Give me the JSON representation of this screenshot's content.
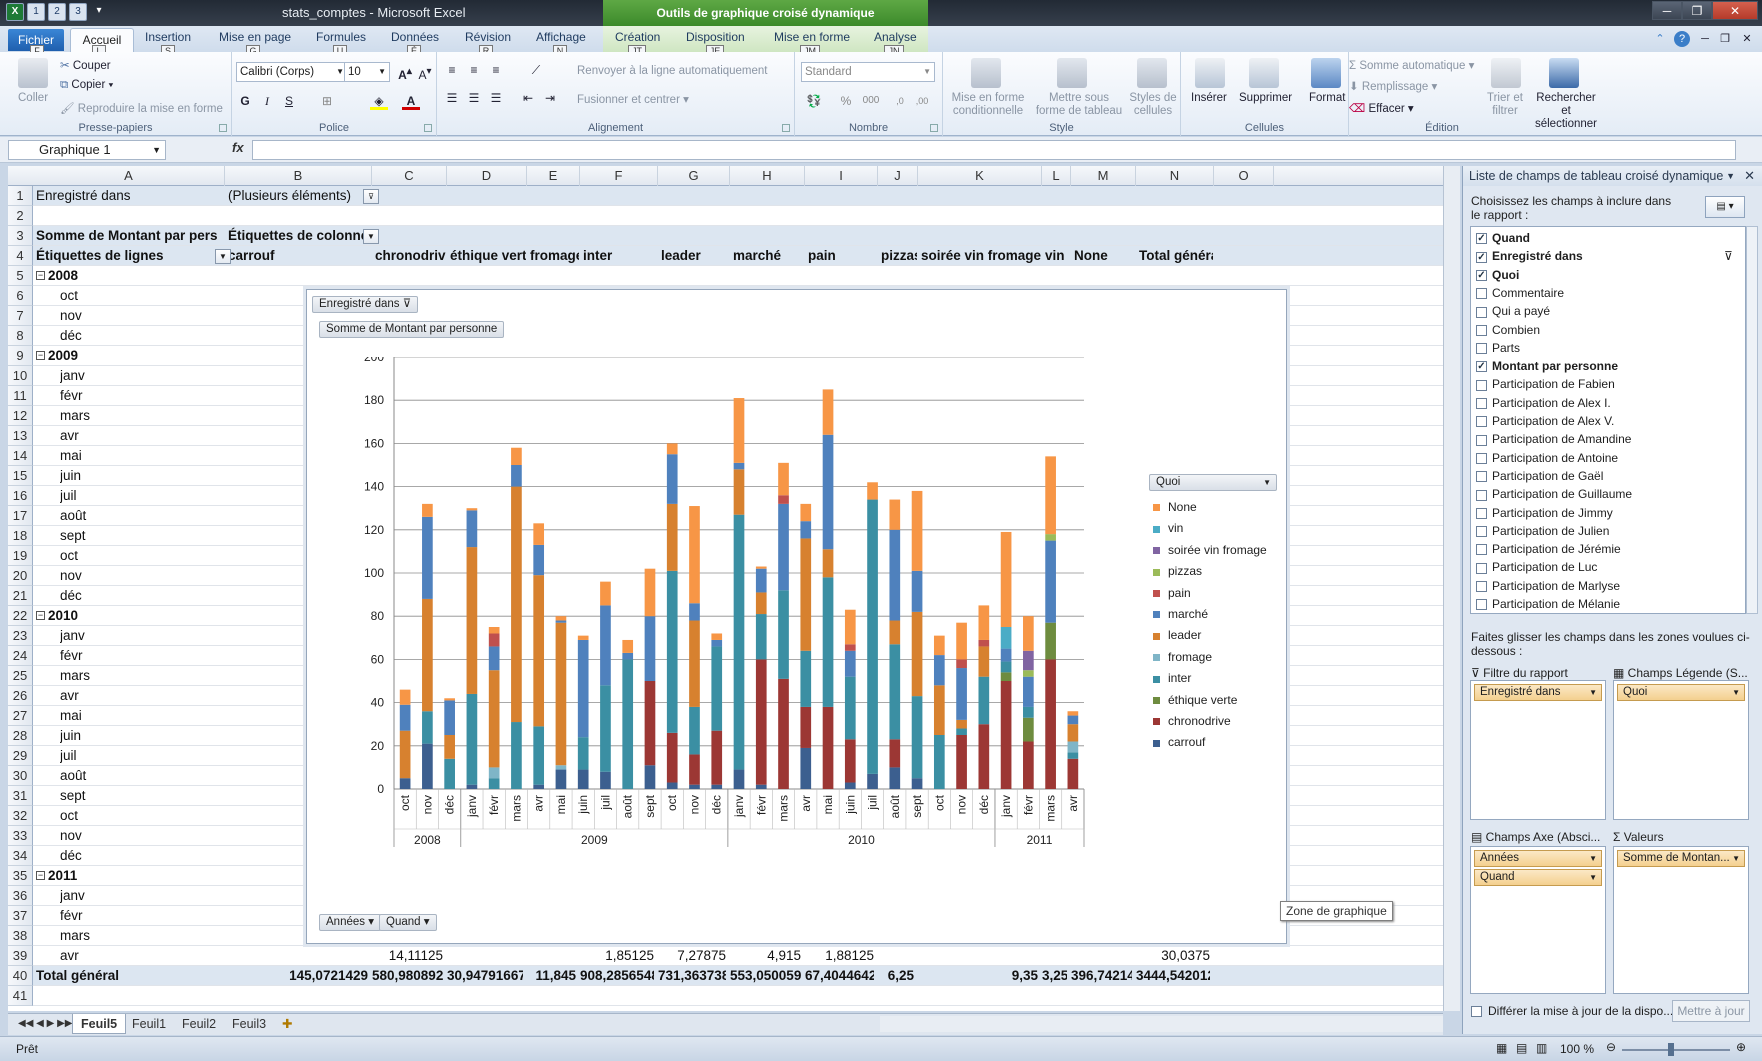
{
  "window": {
    "title": "stats_comptes  -  Microsoft Excel",
    "context_tab_title": "Outils de graphique croisé dynamique"
  },
  "qat_keytips": [
    "1",
    "2",
    "3"
  ],
  "tabs": [
    {
      "label": "Fichier",
      "key": "F"
    },
    {
      "label": "Accueil",
      "key": "L"
    },
    {
      "label": "Insertion",
      "key": "S"
    },
    {
      "label": "Mise en page",
      "key": "G"
    },
    {
      "label": "Formules",
      "key": "U"
    },
    {
      "label": "Données",
      "key": "É"
    },
    {
      "label": "Révision",
      "key": "R"
    },
    {
      "label": "Affichage",
      "key": "N"
    },
    {
      "label": "Création",
      "key": "JT"
    },
    {
      "label": "Disposition",
      "key": "JE"
    },
    {
      "label": "Mise en forme",
      "key": "JM"
    },
    {
      "label": "Analyse",
      "key": "JN"
    }
  ],
  "ribbon": {
    "clipboard": {
      "label": "Presse-papiers",
      "paste": "Coller",
      "cut": "Couper",
      "copy": "Copier",
      "format_painter": "Reproduire la mise en forme"
    },
    "font": {
      "label": "Police",
      "name": "Calibri (Corps)",
      "size": "10",
      "bold": "G",
      "italic": "I",
      "underline": "S"
    },
    "alignment": {
      "label": "Alignement",
      "wrap": "Renvoyer à la ligne automatiquement",
      "merge": "Fusionner et centrer"
    },
    "number": {
      "label": "Nombre",
      "format": "Standard",
      "percent": "%",
      "thousands": "000"
    },
    "style": {
      "label": "Style",
      "conditional": "Mise en forme conditionnelle",
      "as_table": "Mettre sous forme de tableau",
      "cell_styles": "Styles de cellules"
    },
    "cells": {
      "label": "Cellules",
      "insert": "Insérer",
      "delete": "Supprimer",
      "format": "Format"
    },
    "editing": {
      "label": "Édition",
      "autosum": "Somme automatique",
      "fill": "Remplissage",
      "clear": "Effacer",
      "sort": "Trier et filtrer",
      "find": "Rechercher et sélectionner"
    }
  },
  "formula_bar": {
    "name_box": "Graphique 1",
    "fx": "fx",
    "value": ""
  },
  "columns": [
    "A",
    "B",
    "C",
    "D",
    "E",
    "F",
    "G",
    "H",
    "I",
    "J",
    "K",
    "L",
    "M",
    "N",
    "O"
  ],
  "rows": [
    {
      "n": "1",
      "cells": {
        "A": "Enregistré dans",
        "B": "(Plusieurs éléments)"
      }
    },
    {
      "n": "2",
      "cells": {}
    },
    {
      "n": "3",
      "cells": {
        "A": "Somme de Montant par personne",
        "B": "Étiquettes de colonnes"
      }
    },
    {
      "n": "4",
      "cells": {
        "A": "Étiquettes de lignes",
        "B": "carrouf",
        "C": "chronodrive",
        "D": "éthique verte",
        "E": "fromage",
        "F": "inter",
        "G": "leader",
        "H": "marché",
        "I": "pain",
        "J": "pizzas",
        "K": "soirée vin fromage",
        "L": "vin",
        "M": "None",
        "N": "Total général"
      }
    },
    {
      "n": "5",
      "cells": {
        "A": "2008"
      },
      "group": true
    },
    {
      "n": "6",
      "cells": {
        "A": "oct",
        "N": "45,68"
      }
    },
    {
      "n": "7",
      "cells": {
        "A": "nov",
        "N": "132,0861905"
      }
    },
    {
      "n": "8",
      "cells": {
        "A": "déc",
        "N": "42,19833333"
      }
    },
    {
      "n": "9",
      "cells": {
        "A": "2009"
      },
      "group": true
    },
    {
      "n": "10",
      "cells": {
        "A": "janv",
        "N": "130,1457143"
      }
    },
    {
      "n": "11",
      "cells": {
        "A": "févr",
        "N": "69,30671429"
      }
    },
    {
      "n": "12",
      "cells": {
        "A": "mars",
        "N": "157,207619"
      }
    },
    {
      "n": "13",
      "cells": {
        "A": "avr",
        "N": "123,1095238"
      }
    },
    {
      "n": "14",
      "cells": {
        "A": "mai",
        "N": "80,89"
      }
    },
    {
      "n": "15",
      "cells": {
        "A": "juin",
        "N": "71,04142857"
      }
    },
    {
      "n": "16",
      "cells": {
        "A": "juil",
        "N": "104,9130952"
      }
    },
    {
      "n": "17",
      "cells": {
        "A": "août",
        "N": "69,32833333"
      }
    },
    {
      "n": "18",
      "cells": {
        "A": "sept",
        "N": "103,3485714"
      }
    },
    {
      "n": "19",
      "cells": {
        "A": "oct",
        "N": "159,3019048"
      }
    },
    {
      "n": "20",
      "cells": {
        "A": "nov",
        "N": "130,2464286"
      }
    },
    {
      "n": "21",
      "cells": {
        "A": "déc",
        "N": "72,54"
      }
    },
    {
      "n": "22",
      "cells": {
        "A": "2010"
      },
      "group": true
    },
    {
      "n": "23",
      "cells": {
        "A": "janv",
        "N": "180,5357143"
      }
    },
    {
      "n": "24",
      "cells": {
        "A": "févr",
        "N": "103,6347619"
      }
    },
    {
      "n": "25",
      "cells": {
        "A": "mars",
        "N": "150,9516667"
      }
    },
    {
      "n": "26",
      "cells": {
        "A": "avr",
        "N": "132,2630952"
      }
    },
    {
      "n": "27",
      "cells": {
        "A": "mai",
        "N": "185,0585714"
      }
    },
    {
      "n": "28",
      "cells": {
        "A": "juin",
        "N": "100,6852381"
      }
    },
    {
      "n": "29",
      "cells": {
        "A": "juil",
        "N": "141,5328095"
      }
    },
    {
      "n": "30",
      "cells": {
        "A": "août",
        "N": "132,5071429"
      }
    },
    {
      "n": "31",
      "cells": {
        "A": "sept",
        "N": "139,502857"
      }
    },
    {
      "n": "32",
      "cells": {
        "A": "oct",
        "N": "97,31285714"
      }
    },
    {
      "n": "33",
      "cells": {
        "A": "nov",
        "N": "75,77714286"
      }
    },
    {
      "n": "34",
      "cells": {
        "A": "déc",
        "N": "85,54880952"
      }
    },
    {
      "n": "35",
      "cells": {
        "A": "2011"
      },
      "group": true
    },
    {
      "n": "36",
      "cells": {
        "A": "janv",
        "N": "128,9645238"
      }
    },
    {
      "n": "37",
      "cells": {
        "A": "févr",
        "N": "113,6011905"
      }
    },
    {
      "n": "38",
      "cells": {
        "A": "mars",
        "N": "154,5212501"
      }
    },
    {
      "n": "39",
      "cells": {
        "A": "avr",
        "C": "14,11125",
        "F": "1,85125",
        "G": "7,27875",
        "H": "4,915",
        "I": "1,88125",
        "N": "30,0375"
      }
    },
    {
      "n": "40",
      "cells": {
        "A": "Total général",
        "B": "145,0721429",
        "C": "580,9808929",
        "D": "30,94791667",
        "E": "11,845",
        "F": "908,2856548",
        "G": "731,3637381",
        "H": "553,0500595",
        "I": "67,40446429",
        "J": "6,25",
        "K": "9,35",
        "L": "3,25",
        "M": "396,742143",
        "N": "3444,542012"
      },
      "total": true
    },
    {
      "n": "41",
      "cells": {}
    }
  ],
  "chart_buttons": {
    "report_filter": "Enregistré dans",
    "values": "Somme de Montant par personne",
    "legend_field": "Quoi",
    "axis_years": "Années",
    "axis_when": "Quand"
  },
  "chart_tooltip": "Zone de graphique",
  "chart_data": {
    "type": "bar",
    "stacked": true,
    "ylim": [
      0,
      200
    ],
    "yticks": [
      0,
      20,
      40,
      60,
      80,
      100,
      120,
      140,
      160,
      180,
      200
    ],
    "grid": true,
    "legend_placement": "right",
    "categories": [
      "oct",
      "nov",
      "déc",
      "janv",
      "févr",
      "mars",
      "avr",
      "mai",
      "juin",
      "juil",
      "août",
      "sept",
      "oct",
      "nov",
      "déc",
      "janv",
      "févr",
      "mars",
      "avr",
      "mai",
      "juin",
      "juil",
      "août",
      "sept",
      "oct",
      "nov",
      "déc",
      "janv",
      "févr",
      "mars",
      "avr"
    ],
    "year_groups": [
      {
        "label": "2008",
        "count": 3
      },
      {
        "label": "2009",
        "count": 12
      },
      {
        "label": "2010",
        "count": 12
      },
      {
        "label": "2011",
        "count": 4
      }
    ],
    "series": [
      {
        "name": "carrouf",
        "color": "#3c5f8f",
        "values": [
          5,
          21,
          0,
          2,
          0,
          0,
          2,
          9,
          9,
          8,
          0,
          11,
          3,
          2,
          2,
          9,
          2,
          0,
          19,
          0,
          3,
          7,
          10,
          5,
          0,
          0,
          0,
          0,
          0,
          0,
          0
        ]
      },
      {
        "name": "chronodrive",
        "color": "#9c3734",
        "values": [
          0,
          0,
          0,
          0,
          0,
          0,
          0,
          0,
          0,
          0,
          0,
          39,
          23,
          14,
          25,
          0,
          58,
          51,
          19,
          38,
          20,
          0,
          13,
          0,
          0,
          25,
          30,
          50,
          22,
          60,
          14
        ]
      },
      {
        "name": "éthique verte",
        "color": "#6e8c3f",
        "values": [
          0,
          0,
          0,
          0,
          0,
          0,
          0,
          0,
          0,
          0,
          0,
          0,
          0,
          0,
          0,
          0,
          0,
          0,
          0,
          0,
          0,
          0,
          0,
          0,
          0,
          0,
          0,
          4,
          11,
          17,
          0
        ]
      },
      {
        "name": "inter",
        "color": "#3b8fa3",
        "values": [
          0,
          15,
          14,
          42,
          5,
          31,
          27,
          0,
          15,
          40,
          60,
          0,
          75,
          22,
          39,
          118,
          21,
          41,
          26,
          60,
          29,
          127,
          44,
          38,
          25,
          3,
          22,
          5,
          5,
          0,
          3
        ]
      },
      {
        "name": "fromage",
        "color": "#7fb5c7",
        "values": [
          0,
          0,
          0,
          0,
          5,
          0,
          0,
          2,
          0,
          0,
          0,
          0,
          0,
          0,
          0,
          0,
          0,
          0,
          0,
          0,
          0,
          0,
          0,
          0,
          0,
          0,
          0,
          0,
          0,
          0,
          5
        ]
      },
      {
        "name": "leader",
        "color": "#d7812f",
        "values": [
          22,
          52,
          11,
          68,
          45,
          109,
          70,
          66,
          0,
          0,
          0,
          0,
          31,
          40,
          0,
          21,
          10,
          0,
          52,
          13,
          0,
          0,
          11,
          39,
          23,
          4,
          14,
          0,
          0,
          0,
          8
        ]
      },
      {
        "name": "marché",
        "color": "#4f81bd",
        "values": [
          12,
          38,
          16,
          17,
          11,
          10,
          14,
          1,
          45,
          37,
          3,
          30,
          23,
          8,
          3,
          3,
          11,
          40,
          8,
          53,
          12,
          0,
          42,
          19,
          14,
          24,
          0,
          6,
          14,
          38,
          4
        ]
      },
      {
        "name": "pain",
        "color": "#c0504d",
        "values": [
          0,
          0,
          0,
          0,
          6,
          0,
          0,
          0,
          0,
          0,
          0,
          0,
          0,
          0,
          0,
          0,
          0,
          4,
          0,
          0,
          3,
          0,
          0,
          0,
          0,
          4,
          3,
          0,
          0,
          0,
          0
        ]
      },
      {
        "name": "pizzas",
        "color": "#9bbb59",
        "values": [
          0,
          0,
          0,
          0,
          0,
          0,
          0,
          0,
          0,
          0,
          0,
          0,
          0,
          0,
          0,
          0,
          0,
          0,
          0,
          0,
          0,
          0,
          0,
          0,
          0,
          0,
          0,
          0,
          3,
          3,
          0
        ]
      },
      {
        "name": "soirée vin fromage",
        "color": "#8064a2",
        "values": [
          0,
          0,
          0,
          0,
          0,
          0,
          0,
          0,
          0,
          0,
          0,
          0,
          0,
          0,
          0,
          0,
          0,
          0,
          0,
          0,
          0,
          0,
          0,
          0,
          0,
          0,
          0,
          0,
          9,
          0,
          0
        ]
      },
      {
        "name": "vin",
        "color": "#4bacc6",
        "values": [
          0,
          0,
          0,
          0,
          0,
          0,
          0,
          0,
          0,
          0,
          0,
          0,
          0,
          0,
          0,
          0,
          0,
          0,
          0,
          0,
          0,
          0,
          0,
          0,
          0,
          0,
          0,
          10,
          0,
          0,
          0
        ]
      },
      {
        "name": "None",
        "color": "#f79646",
        "values": [
          7,
          6,
          1,
          1,
          3,
          8,
          10,
          2,
          2,
          11,
          6,
          22,
          5,
          45,
          3,
          30,
          1,
          15,
          8,
          21,
          16,
          8,
          14,
          37,
          9,
          17,
          16,
          44,
          16,
          36,
          2
        ]
      }
    ]
  },
  "sheets": [
    {
      "name": "Feuil5",
      "active": true
    },
    {
      "name": "Feuil1"
    },
    {
      "name": "Feuil2"
    },
    {
      "name": "Feuil3"
    }
  ],
  "status": {
    "ready": "Prêt",
    "zoom": "100 %"
  },
  "pane": {
    "title": "Liste de champs de tableau croisé dynamique",
    "desc": "Choisissez les champs à inclure dans le rapport :",
    "fields": [
      {
        "label": "Quand",
        "checked": true
      },
      {
        "label": "Enregistré dans",
        "checked": true
      },
      {
        "label": "Quoi",
        "checked": true
      },
      {
        "label": "Commentaire"
      },
      {
        "label": "Qui a payé"
      },
      {
        "label": "Combien"
      },
      {
        "label": "Parts"
      },
      {
        "label": "Montant par personne",
        "checked": true
      },
      {
        "label": "Participation de Fabien"
      },
      {
        "label": "Participation de Alex I."
      },
      {
        "label": "Participation de Alex V."
      },
      {
        "label": "Participation de Amandine"
      },
      {
        "label": "Participation de Antoine"
      },
      {
        "label": "Participation de Gaël"
      },
      {
        "label": "Participation de Guillaume"
      },
      {
        "label": "Participation de Jimmy"
      },
      {
        "label": "Participation de Julien"
      },
      {
        "label": "Participation de Jérémie"
      },
      {
        "label": "Participation de Luc"
      },
      {
        "label": "Participation de Marlyse"
      },
      {
        "label": "Participation de Mélanie"
      }
    ],
    "drag_text": "Faites glisser les champs dans les zones voulues ci-dessous :",
    "zones": {
      "filter_label": "Filtre du rapport",
      "filter_items": [
        "Enregistré dans"
      ],
      "legend_label": "Champs Légende (S...",
      "legend_items": [
        "Quoi"
      ],
      "axis_label": "Champs Axe (Absci...",
      "axis_items": [
        "Années",
        "Quand"
      ],
      "values_label": "Valeurs",
      "values_items": [
        "Somme de Montan..."
      ]
    },
    "defer": "Différer la mise à jour de la dispo...",
    "update": "Mettre à jour"
  }
}
